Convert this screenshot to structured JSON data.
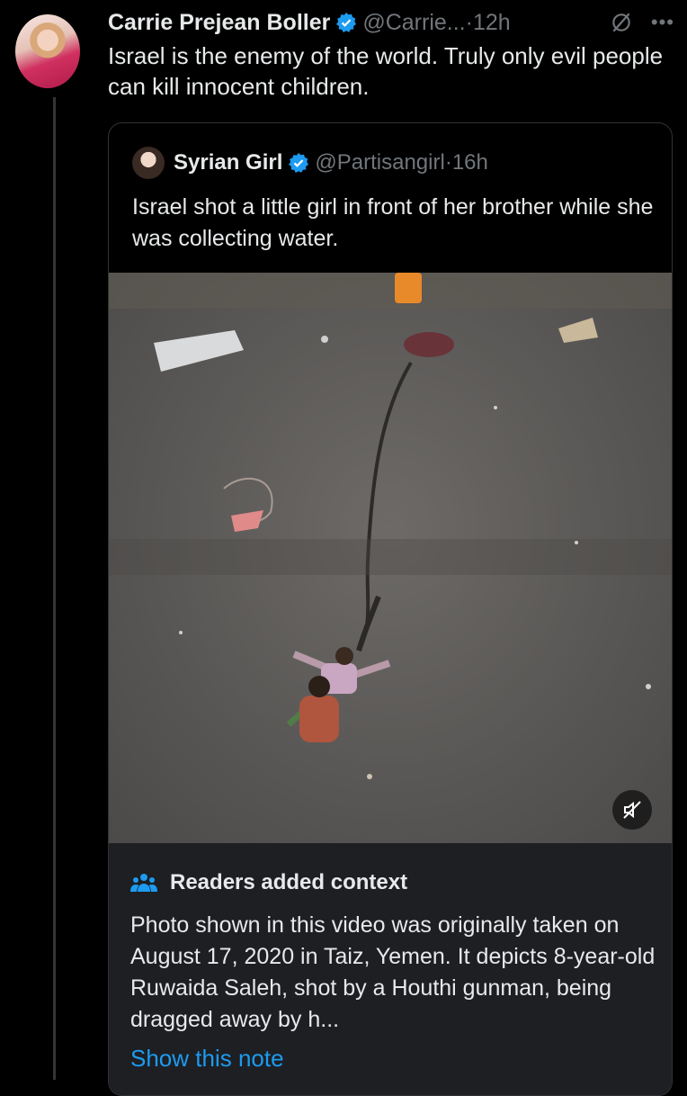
{
  "tweet": {
    "author_name": "Carrie Prejean Boller",
    "handle": "@Carrie...",
    "separator": "·",
    "time": "12h",
    "text": "Israel is the enemy of the world. Truly only evil people can kill innocent children."
  },
  "quote": {
    "author_name": "Syrian Girl",
    "handle": "@Partisangirl",
    "separator": "·",
    "time": "16h",
    "text": "Israel shot a little girl in front of her brother while she was collecting water."
  },
  "community_note": {
    "title": "Readers added context",
    "body": "Photo shown in this video was originally taken on August 17, 2020 in Taiz, Yemen. It depicts 8-year-old Ruwaida Saleh, shot by a Houthi gunman, being dragged away by h...",
    "link": "Show this note"
  },
  "colors": {
    "background": "#000000",
    "verified": "#1d9bf0",
    "link": "#1d9bf0",
    "note_bg": "#1d1f23"
  },
  "icons": [
    "verified-badge-icon",
    "grok-icon",
    "more-icon",
    "mute-icon",
    "people-icon"
  ]
}
